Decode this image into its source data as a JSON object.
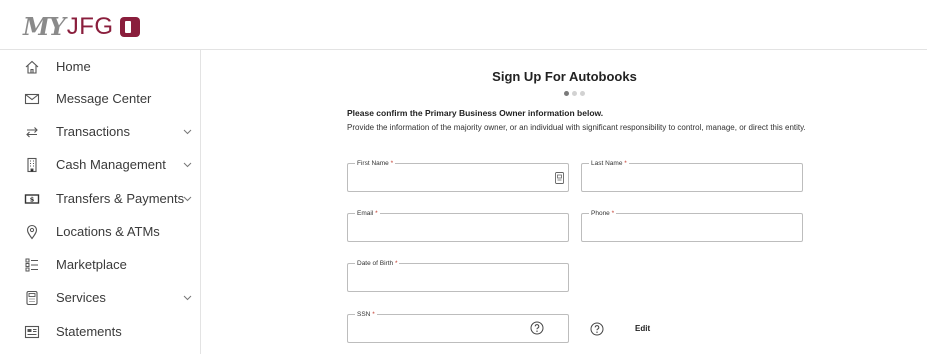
{
  "header": {
    "logo_my": "MY",
    "logo_jfg": "JFG"
  },
  "sidebar": {
    "items": [
      {
        "label": "Home",
        "icon": "home-icon",
        "expandable": false
      },
      {
        "label": "Message Center",
        "icon": "envelope-icon",
        "expandable": false
      },
      {
        "label": "Transactions",
        "icon": "transfer-arrows-icon",
        "expandable": true
      },
      {
        "label": "Cash Management",
        "icon": "building-icon",
        "expandable": true
      },
      {
        "label": "Transfers & Payments",
        "icon": "dollar-bill-icon",
        "expandable": true
      },
      {
        "label": "Locations & ATMs",
        "icon": "location-pin-icon",
        "expandable": false
      },
      {
        "label": "Marketplace",
        "icon": "list-icon",
        "expandable": false
      },
      {
        "label": "Services",
        "icon": "calculator-icon",
        "expandable": true
      },
      {
        "label": "Statements",
        "icon": "statement-icon",
        "expandable": false
      }
    ]
  },
  "main": {
    "title": "Sign Up For Autobooks",
    "step": {
      "current": 1,
      "total": 3
    },
    "heading": "Please confirm the Primary Business Owner information below.",
    "description": "Provide the information of the majority owner, or an individual with significant responsibility to control, manage, or direct this entity.",
    "fields": {
      "first_name": {
        "label": "First Name",
        "required_mark": "*",
        "value": ""
      },
      "last_name": {
        "label": "Last Name",
        "required_mark": "*",
        "value": ""
      },
      "email": {
        "label": "Email",
        "required_mark": "*",
        "value": ""
      },
      "phone": {
        "label": "Phone",
        "required_mark": "*",
        "value": ""
      },
      "dob": {
        "label": "Date of Birth",
        "required_mark": "*",
        "value": ""
      },
      "ssn": {
        "label": "SSN",
        "required_mark": "*",
        "value": ""
      }
    },
    "edit_label": "Edit"
  },
  "colors": {
    "brand": "#8a1e3c",
    "border": "#bdbdbd",
    "required": "#c0392b"
  }
}
